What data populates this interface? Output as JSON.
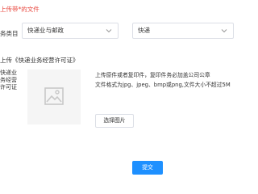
{
  "title": "上传带*的文件",
  "category": {
    "label": "务类目",
    "primary_value": "快递业与邮政",
    "secondary_value": "快递"
  },
  "upload": {
    "heading": "上传《快递业务经营许可证》",
    "side_label": "快递业务经营许可证",
    "hint_line1": "上传原件或者复印件，复印件务必加盖公司公章",
    "hint_line2": "文件格式为jpg、jpeg、bmp或png,文件大小不超过5M",
    "choose_label": "选择图片"
  },
  "submit_label": "提交",
  "colors": {
    "accent": "#1e90ff",
    "title_red": "#e8453c",
    "placeholder_bg": "#f5f5f5"
  },
  "icons": {
    "image_placeholder": "image-icon",
    "dropdown": "chevron-down-icon"
  }
}
